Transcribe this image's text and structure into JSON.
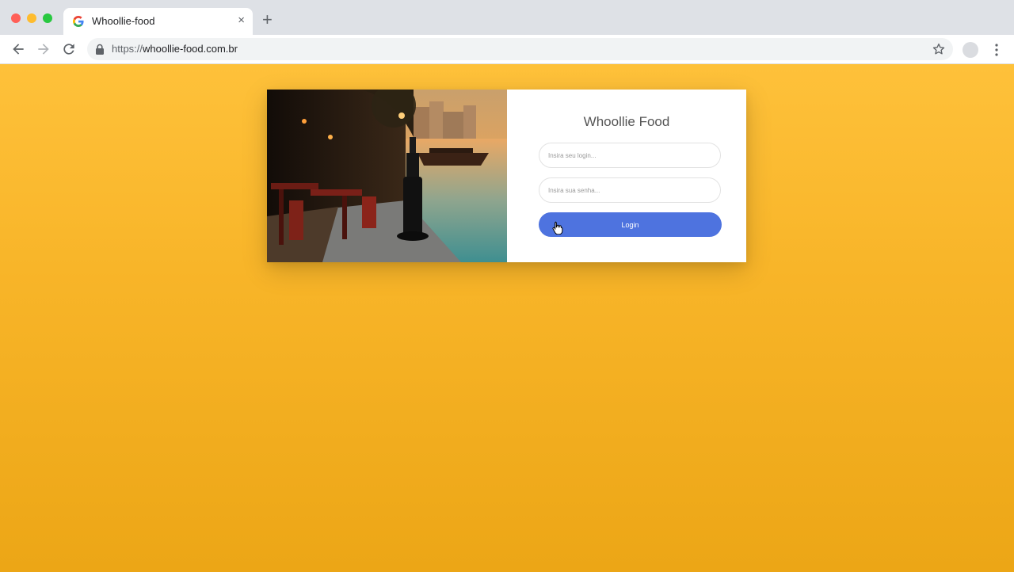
{
  "browser": {
    "tab_title": "Whoollie-food",
    "tab_close": "×",
    "new_tab": "+",
    "url_scheme": "https://",
    "url_host": "whoollie-food.com.br",
    "icons": [
      "google-favicon-icon",
      "back-arrow-icon",
      "forward-arrow-icon",
      "reload-icon",
      "lock-icon",
      "star-icon",
      "profile-avatar",
      "more-vert-icon"
    ]
  },
  "login": {
    "title": "Whoollie Food",
    "username_placeholder": "Insira seu login...",
    "password_placeholder": "Insira sua senha...",
    "button_label": "Login"
  },
  "colors": {
    "background_top": "#fec13a",
    "background_bottom": "#eca616",
    "button": "#4e73df"
  }
}
